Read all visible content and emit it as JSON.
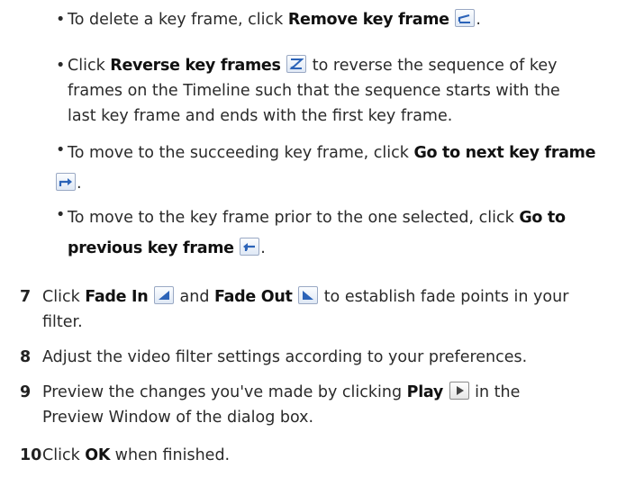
{
  "bullets": [
    {
      "before": "To delete a key frame, click ",
      "bold": "Remove key frame",
      "icon": "remove-key-frame-icon",
      "after": "."
    },
    {
      "before": "Click ",
      "bold": "Reverse key frames",
      "icon": "reverse-key-frames-icon",
      "after_lines": [
        " to reverse the sequence of key",
        "frames on the Timeline such that the sequence starts with the",
        "last key frame and ends with the first key frame."
      ]
    },
    {
      "before": "To move to the succeeding key frame, click ",
      "bold": "Go to next key frame",
      "icon": "go-to-next-key-frame-icon",
      "after": "."
    },
    {
      "before": "To move to the key frame prior to the one selected, click ",
      "bold_line1": "Go to",
      "bold_line2": "previous key frame",
      "icon": "go-to-previous-key-frame-icon",
      "after": "."
    }
  ],
  "steps": [
    {
      "number": "7",
      "before": "Click ",
      "bold1": "Fade In",
      "icon1": "fade-in-icon",
      "middle": " and ",
      "bold2": "Fade Out",
      "icon2": "fade-out-icon",
      "after_line1": " to establish fade points in your",
      "after_line2": "filter."
    },
    {
      "number": "8",
      "text": "Adjust the video filter settings according to your preferences."
    },
    {
      "number": "9",
      "before": "Preview the changes you've made by clicking ",
      "bold": "Play",
      "icon": "play-icon",
      "after_line1": " in the",
      "after_line2": "Preview Window of the dialog box."
    },
    {
      "number": "10",
      "before": "Click ",
      "bold": "OK",
      "after": " when finished."
    }
  ]
}
